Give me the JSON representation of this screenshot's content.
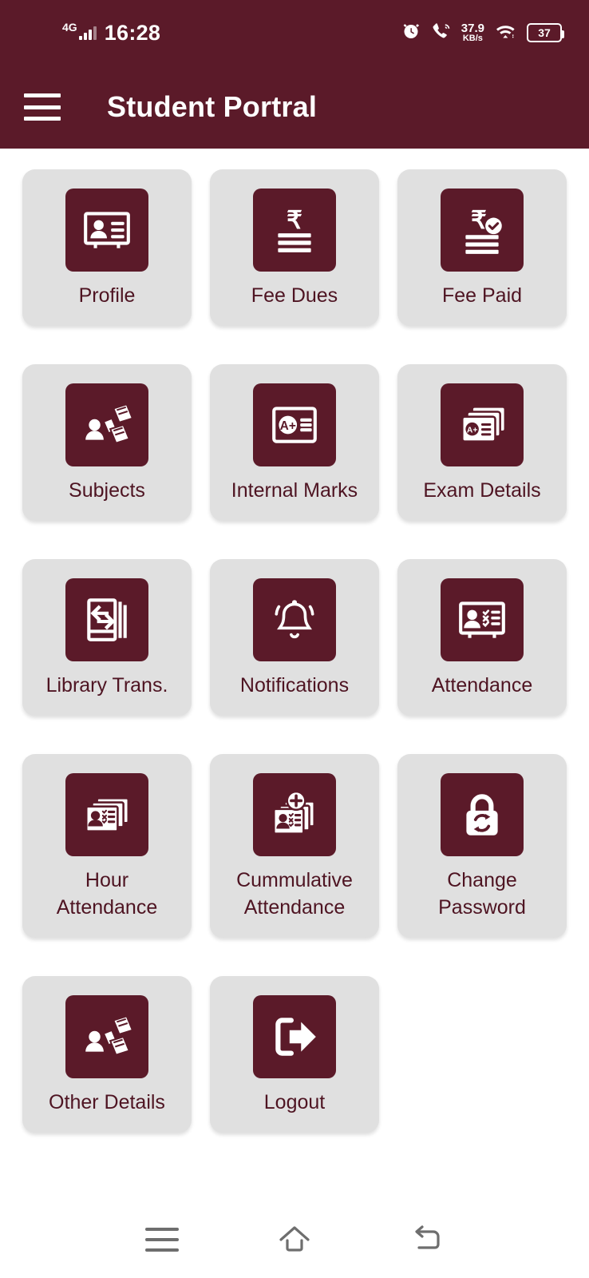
{
  "status_bar": {
    "network_type": "4G",
    "time": "16:28",
    "alarm_icon": "alarm-clock-icon",
    "call_wifi_icon": "wifi-calling-icon",
    "net_speed_value": "37.9",
    "net_speed_unit": "KB/s",
    "wifi_icon": "wifi-icon",
    "battery_level": "37"
  },
  "app_bar": {
    "menu_icon": "hamburger-menu-icon",
    "title": "Student Portral"
  },
  "grid": {
    "tiles": [
      {
        "label": "Profile",
        "icon": "id-card-person-icon"
      },
      {
        "label": "Fee Dues",
        "icon": "rupee-bill-icon"
      },
      {
        "label": "Fee Paid",
        "icon": "rupee-bill-check-icon"
      },
      {
        "label": "Subjects",
        "icon": "person-books-icon"
      },
      {
        "label": "Internal Marks",
        "icon": "a-plus-card-icon"
      },
      {
        "label": "Exam Details",
        "icon": "a-plus-cards-stack-icon"
      },
      {
        "label": "Library Trans.",
        "icon": "book-exchange-icon"
      },
      {
        "label": "Notifications",
        "icon": "bell-icon"
      },
      {
        "label": "Attendance",
        "icon": "id-card-checklist-icon"
      },
      {
        "label": "Hour\nAttendance",
        "icon": "id-cards-stack-checklist-icon"
      },
      {
        "label": "Cummulative\nAttendance",
        "icon": "id-cards-stack-plus-icon"
      },
      {
        "label": "Change\nPassword",
        "icon": "padlock-refresh-icon"
      },
      {
        "label": "Other Details",
        "icon": "person-books-icon"
      },
      {
        "label": "Logout",
        "icon": "exit-arrow-icon"
      }
    ]
  },
  "nav_bar": {
    "recents_icon": "recents-menu-icon",
    "home_icon": "home-icon",
    "back_icon": "back-arrow-icon"
  },
  "colors": {
    "brand_maroon": "#5B1A29",
    "tile_gray": "#E0E0E0",
    "label_text": "#4E1422",
    "page_background": "#FFFFFF",
    "nav_icon_gray": "#6E6E6E"
  }
}
